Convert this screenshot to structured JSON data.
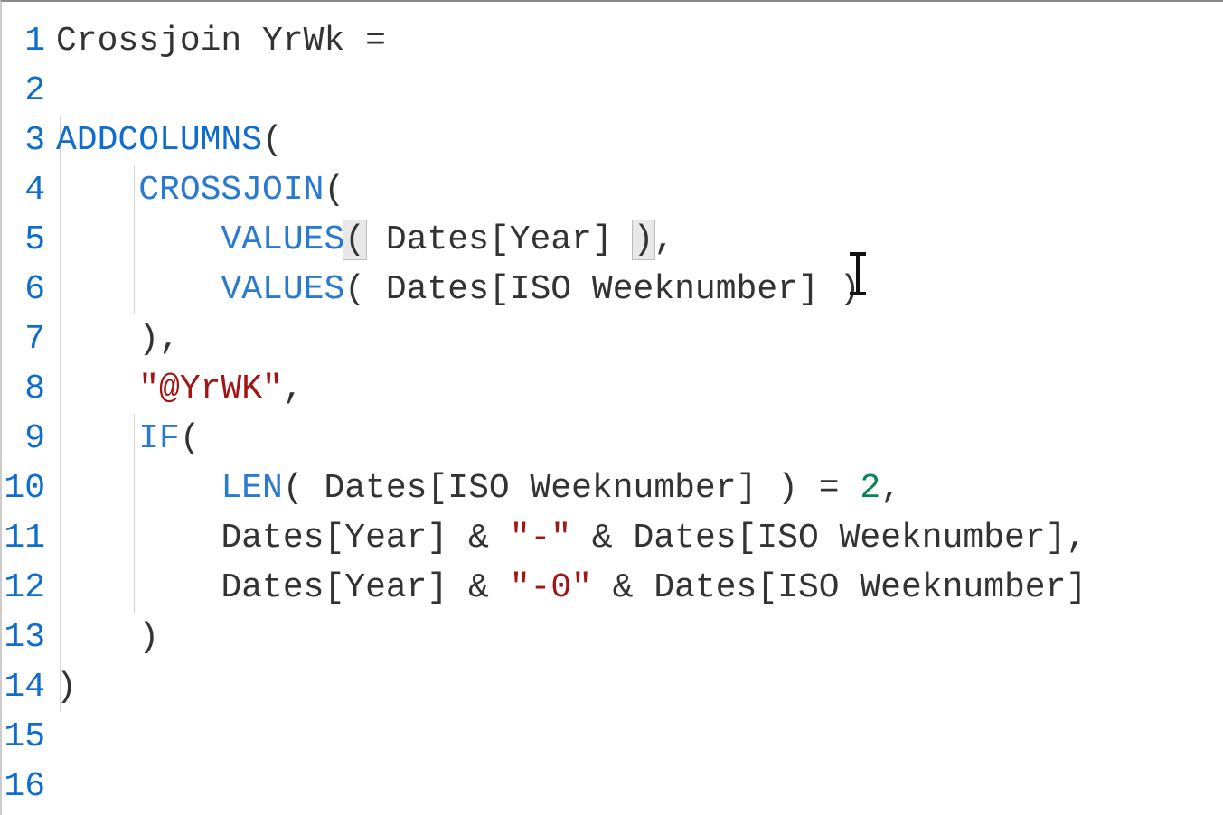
{
  "editor": {
    "line_numbers": [
      "1",
      "2",
      "3",
      "4",
      "5",
      "6",
      "7",
      "8",
      "9",
      "10",
      "11",
      "12",
      "13",
      "14",
      "15",
      "16"
    ],
    "lines": {
      "l1": {
        "ident": "Crossjoin YrWk ",
        "eq": "="
      },
      "l2": {
        "text": ""
      },
      "l3": {
        "func": "ADDCOLUMNS",
        "open": "("
      },
      "l4": {
        "indent": "    ",
        "func": "CROSSJOIN",
        "open": "("
      },
      "l5": {
        "indent": "        ",
        "func": "VALUES",
        "open": "(",
        "sp1": " ",
        "ref": "Dates[Year]",
        "sp2": " ",
        "close": ")",
        "comma": ","
      },
      "l6": {
        "indent": "        ",
        "func": "VALUES",
        "open": "( ",
        "ref": "Dates[ISO Weeknumber]",
        "close": " )"
      },
      "l7": {
        "indent": "    ",
        "close": ")",
        "comma": ","
      },
      "l8": {
        "indent": "    ",
        "string": "\"@YrWK\"",
        "comma": ","
      },
      "l9": {
        "indent": "    ",
        "func": "IF",
        "open": "("
      },
      "l10": {
        "indent": "        ",
        "func": "LEN",
        "open": "( ",
        "ref": "Dates[ISO Weeknumber]",
        "close": " )",
        "eq": " = ",
        "num": "2",
        "comma": ","
      },
      "l11": {
        "indent": "        ",
        "ref1": "Dates[Year]",
        "amp1": " & ",
        "str": "\"-\"",
        "amp2": " & ",
        "ref2": "Dates[ISO Weeknumber]",
        "comma": ","
      },
      "l12": {
        "indent": "        ",
        "ref1": "Dates[Year]",
        "amp1": " & ",
        "str": "\"-0\"",
        "amp2": " & ",
        "ref2": "Dates[ISO Weeknumber]"
      },
      "l13": {
        "indent": "    ",
        "close": ")"
      },
      "l14": {
        "close": ")"
      },
      "l15": {
        "text": ""
      },
      "l16": {
        "text": ""
      }
    }
  }
}
